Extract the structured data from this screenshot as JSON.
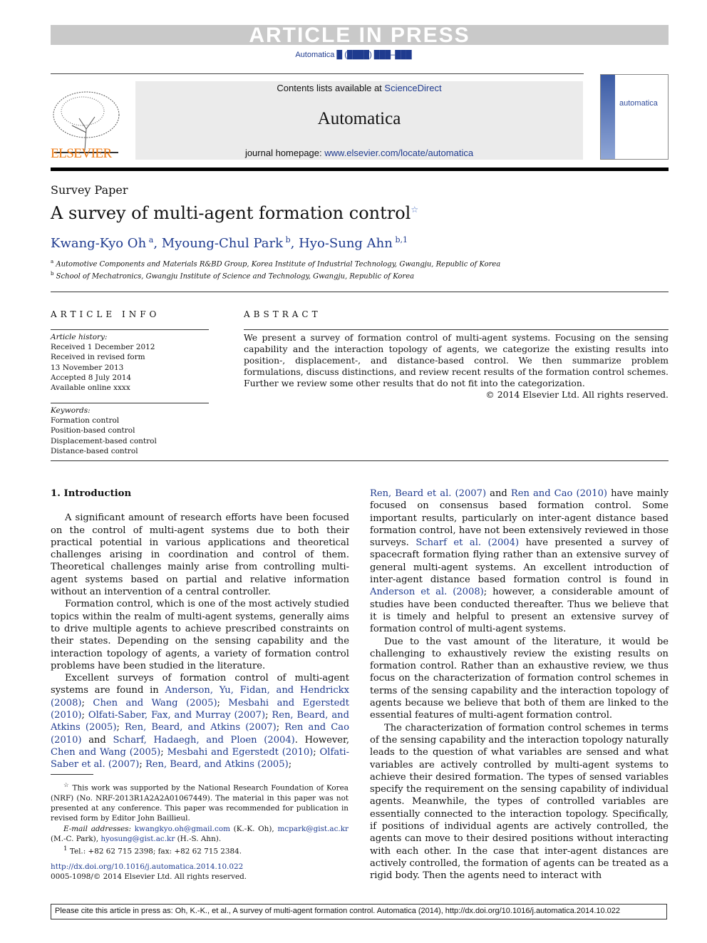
{
  "banner": "ARTICLE IN PRESS",
  "journal_ref": "Automatica █ (████) ███–███",
  "masthead": {
    "contents_prefix": "Contents lists available at ",
    "sciencedirect": "ScienceDirect",
    "journal": "Automatica",
    "homepage_prefix": "journal homepage: ",
    "homepage_url": "www.elsevier.com/locate/automatica",
    "publisher": "ELSEVIER",
    "cover_title": "automatica"
  },
  "article": {
    "type": "Survey Paper",
    "title": "A survey of multi-agent formation control",
    "title_mark": "☆",
    "authors": [
      {
        "name": "Kwang-Kyo Oh",
        "sup": "a"
      },
      {
        "name": "Myoung-Chul Park",
        "sup": "b"
      },
      {
        "name": "Hyo-Sung Ahn",
        "sup": "b,1"
      }
    ],
    "affiliations": [
      {
        "sup": "a",
        "text": "Automotive Components and Materials R&BD Group, Korea Institute of Industrial Technology, Gwangju, Republic of Korea"
      },
      {
        "sup": "b",
        "text": "School of Mechatronics, Gwangju Institute of Science and Technology, Gwangju, Republic of Korea"
      }
    ]
  },
  "article_info": {
    "heading": "ARTICLE INFO",
    "history_label": "Article history:",
    "history": [
      "Received 1 December 2012",
      "Received in revised form",
      "13 November 2013",
      "Accepted 8 July 2014",
      "Available online xxxx"
    ],
    "keywords_label": "Keywords:",
    "keywords": [
      "Formation control",
      "Position-based control",
      "Displacement-based control",
      "Distance-based control"
    ]
  },
  "abstract": {
    "heading": "ABSTRACT",
    "text": "We present a survey of formation control of multi-agent systems. Focusing on the sensing capability and the interaction topology of agents, we categorize the existing results into position-, displacement-, and distance-based control. We then summarize problem formulations, discuss distinctions, and review recent results of the formation control schemes. Further we review some other results that do not fit into the categorization.",
    "copyright": "© 2014 Elsevier Ltd. All rights reserved."
  },
  "section": {
    "heading": "1. Introduction"
  },
  "left_paragraphs": [
    [
      {
        "t": "A significant amount of research efforts have been focused on the control of multi-agent systems due to both their practical potential in various applications and theoretical challenges arising in coordination and control of them. Theoretical challenges mainly arise from controlling multi-agent systems based on partial and relative information without an intervention of a central controller."
      }
    ],
    [
      {
        "t": "Formation control, which is one of the most actively studied topics within the realm of multi-agent systems, generally aims to drive multiple agents to achieve prescribed constraints on their states. Depending on the sensing capability and the interaction topology of agents, a variety of formation control problems have been studied in the literature."
      }
    ],
    [
      {
        "t": "Excellent surveys of formation control of multi-agent systems are found in "
      },
      {
        "t": "Anderson, Yu, Fidan, and Hendrickx (2008)",
        "l": 1
      },
      {
        "t": "; "
      },
      {
        "t": "Chen and Wang (2005)",
        "l": 1
      },
      {
        "t": "; "
      },
      {
        "t": "Mesbahi and Egerstedt (2010)",
        "l": 1
      },
      {
        "t": "; "
      },
      {
        "t": "Olfati-Saber, Fax, and Murray (2007)",
        "l": 1
      },
      {
        "t": "; "
      },
      {
        "t": "Ren, Beard, and Atkins (2005)",
        "l": 1
      },
      {
        "t": "; "
      },
      {
        "t": "Ren, Beard, and Atkins (2007)",
        "l": 1
      },
      {
        "t": "; "
      },
      {
        "t": "Ren and Cao (2010)",
        "l": 1
      },
      {
        "t": " and "
      },
      {
        "t": "Scharf, Hadaegh, and Ploen (2004)",
        "l": 1
      },
      {
        "t": ". However, "
      },
      {
        "t": "Chen and Wang (2005)",
        "l": 1
      },
      {
        "t": "; "
      },
      {
        "t": "Mesbahi and Egerstedt (2010)",
        "l": 1
      },
      {
        "t": "; "
      },
      {
        "t": "Olfati-Saber et al. (2007)",
        "l": 1
      },
      {
        "t": "; "
      },
      {
        "t": "Ren, Beard, and Atkins (2005)",
        "l": 1
      },
      {
        "t": ";"
      }
    ]
  ],
  "right_paragraphs": [
    [
      {
        "t": "Ren, Beard et al. (2007)",
        "l": 1
      },
      {
        "t": " and "
      },
      {
        "t": "Ren and Cao (2010)",
        "l": 1
      },
      {
        "t": " have mainly focused on consensus based formation control. Some important results, particularly on inter-agent distance based formation control, have not been extensively reviewed in those surveys. "
      },
      {
        "t": "Scharf et al. (2004)",
        "l": 1
      },
      {
        "t": " have presented a survey of spacecraft formation flying rather than an extensive survey of general multi-agent systems. An excellent introduction of inter-agent distance based formation control is found in "
      },
      {
        "t": "Anderson et al. (2008)",
        "l": 1
      },
      {
        "t": "; however, a considerable amount of studies have been conducted thereafter. Thus we believe that it is timely and helpful to present an extensive survey of formation control of multi-agent systems."
      }
    ],
    [
      {
        "t": "Due to the vast amount of the literature, it would be challenging to exhaustively review the existing results on formation control. Rather than an exhaustive review, we thus focus on the characterization of formation control schemes in terms of the sensing capability and the interaction topology of agents because we believe that both of them are linked to the essential features of multi-agent formation control."
      }
    ],
    [
      {
        "t": "The characterization of formation control schemes in terms of the sensing capability and the interaction topology naturally leads to the question of what variables are sensed and what variables are actively controlled by multi-agent systems to achieve their desired formation. The types of sensed variables specify the requirement on the sensing capability of individual agents. Meanwhile, the types of controlled variables are essentially connected to the interaction topology. Specifically, if positions of individual agents are actively controlled, the agents can move to their desired positions without interacting with each other. In the case that inter-agent distances are actively controlled, the formation of agents can be treated as a rigid body. Then the agents need to interact with"
      }
    ]
  ],
  "footnotes": {
    "star": "☆",
    "star_text": "This work was supported by the National Research Foundation of Korea (NRF) (No. NRF-2013R1A2A2A01067449). The material in this paper was not presented at any conference. This paper was recommended for publication in revised form by Editor John Baillieul.",
    "email_label": "E-mail addresses:",
    "emails": [
      {
        "addr": "kwangkyo.oh@gmail.com",
        "who": " (K.-K. Oh), "
      },
      {
        "addr": "mcpark@gist.ac.kr",
        "who": " (M.-C. Park), "
      },
      {
        "addr": "hyosung@gist.ac.kr",
        "who": " (H.-S. Ahn)."
      }
    ],
    "one": "1",
    "one_text": "Tel.: +82 62 715 2398; fax: +82 62 715 2384."
  },
  "doi": "http://dx.doi.org/10.1016/j.automatica.2014.10.022",
  "issn": "0005-1098/© 2014 Elsevier Ltd. All rights reserved.",
  "cite_bar": "Please cite this article in press as: Oh, K.-K., et al., A survey of multi-agent formation control. Automatica (2014), http://dx.doi.org/10.1016/j.automatica.2014.10.022",
  "colors": {
    "link": "#1f3b8f",
    "elsevier": "#f07a12",
    "banner": "#c9c9c9"
  }
}
